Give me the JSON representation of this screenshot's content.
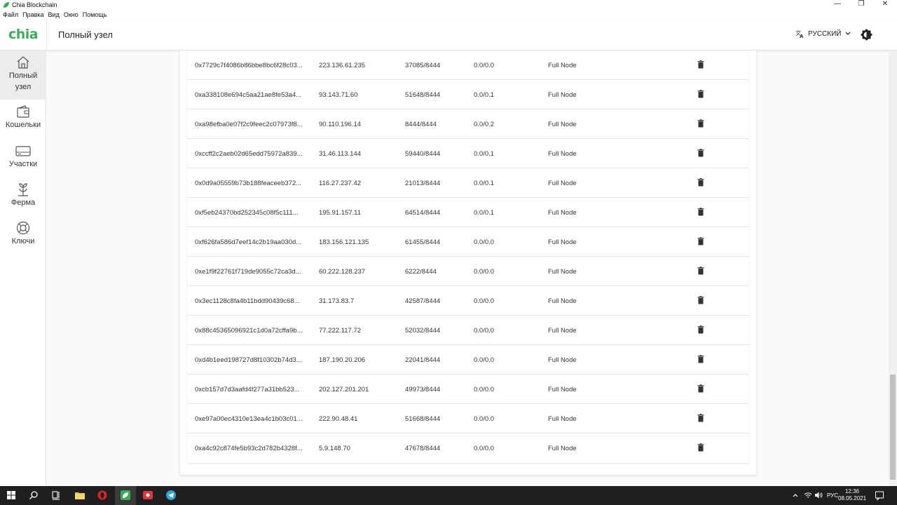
{
  "window": {
    "title": "Chia Blockchain",
    "menu": [
      "Файл",
      "Правка",
      "Вид",
      "Окно",
      "Помощь"
    ],
    "controls": [
      "—",
      "❐",
      "✕"
    ]
  },
  "appbar": {
    "logo": "chia",
    "title": "Полный узел",
    "language": "РУССКИЙ"
  },
  "sidebar": {
    "items": [
      {
        "label_line1": "Полный",
        "label_line2": "узел",
        "icon": "home-icon",
        "active": true
      },
      {
        "label": "Кошельки",
        "icon": "wallet-icon"
      },
      {
        "label": "Участки",
        "icon": "hard-drive-icon"
      },
      {
        "label": "Ферма",
        "icon": "sprout-icon"
      },
      {
        "label": "Ключи",
        "icon": "lifebuoy-icon"
      }
    ]
  },
  "connections": [
    {
      "id": "0x7729c7f4086b86bbe8bc6f28c03...",
      "ip": "223.136.61.235",
      "ports": "37085/8444",
      "updown": "0.0/0.0",
      "type": "Full Node"
    },
    {
      "id": "0xa338108e694c5aa21ae8fe53a4...",
      "ip": "93.143.71.60",
      "ports": "51648/8444",
      "updown": "0.0/0.1",
      "type": "Full Node"
    },
    {
      "id": "0xa98efba0e07f2c9feec2c07973f8...",
      "ip": "90.110.196.14",
      "ports": "8444/8444",
      "updown": "0.0/0.2",
      "type": "Full Node"
    },
    {
      "id": "0xccff2c2aeb02d65edd75972a839...",
      "ip": "31.46.113.144",
      "ports": "59440/8444",
      "updown": "0.0/0.1",
      "type": "Full Node"
    },
    {
      "id": "0x0d9a05559b73b188feaceeb372...",
      "ip": "116.27.237.42",
      "ports": "21013/8444",
      "updown": "0.0/0.1",
      "type": "Full Node"
    },
    {
      "id": "0xf5eb24370bd252345c08f5c111...",
      "ip": "195.91.157.11",
      "ports": "64514/8444",
      "updown": "0.0/0.1",
      "type": "Full Node"
    },
    {
      "id": "0xf626fa586d7eef14c2b19aa030d...",
      "ip": "183.156.121.135",
      "ports": "61455/8444",
      "updown": "0.0/0.0",
      "type": "Full Node"
    },
    {
      "id": "0xe1f9f22761f719de9055c72ca3d...",
      "ip": "60.222.128.237",
      "ports": "6222/8444",
      "updown": "0.0/0.0",
      "type": "Full Node"
    },
    {
      "id": "0x3ec1128c8fa4b11bdd90439c68...",
      "ip": "31.173.83.7",
      "ports": "42587/8444",
      "updown": "0.0/0.0",
      "type": "Full Node"
    },
    {
      "id": "0x88c45365096921c1d0a72cffa9b...",
      "ip": "77.222.117.72",
      "ports": "52032/8444",
      "updown": "0.0/0.0",
      "type": "Full Node"
    },
    {
      "id": "0xd4b1eed198727d8f10302b74d3...",
      "ip": "187.190.20.206",
      "ports": "22041/8444",
      "updown": "0.0/0.0",
      "type": "Full Node"
    },
    {
      "id": "0xcb157d7d3aafd4f277a31bb523...",
      "ip": "202.127.201.201",
      "ports": "49973/8444",
      "updown": "0.0/0.0",
      "type": "Full Node"
    },
    {
      "id": "0xe97a00ec4310e13ea4c1b03c01...",
      "ip": "222.90.48.41",
      "ports": "51668/8444",
      "updown": "0.0/0.0",
      "type": "Full Node"
    },
    {
      "id": "0xa4c92c874fe5b93c2d782b4328f...",
      "ip": "5.9.148.70",
      "ports": "47678/8444",
      "updown": "0.0/0.0",
      "type": "Full Node"
    }
  ],
  "taskbar": {
    "lang": "РУС",
    "time": "12:36",
    "date": "08.05.2021"
  },
  "colors": {
    "brand": "#3aac59",
    "active_nav": "#ececec",
    "taskbar": "#1f1f1f"
  }
}
